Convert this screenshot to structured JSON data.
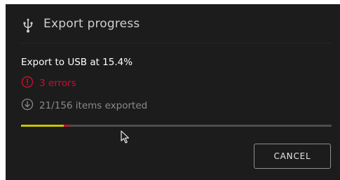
{
  "dialog": {
    "title": "Export progress",
    "title_icon": "usb-icon",
    "status": "Export to USB at 15.4%",
    "progress_percent": 15.4,
    "errors": {
      "icon": "alert-circle-icon",
      "text": "3 errors",
      "color": "#c8102e"
    },
    "exported": {
      "icon": "download-circle-icon",
      "text": "21/156 items exported"
    },
    "progress_colors": {
      "ok": "#c6c400",
      "error": "#c8102e",
      "track": "#4d4d4d"
    },
    "cancel_label": "CANCEL"
  }
}
